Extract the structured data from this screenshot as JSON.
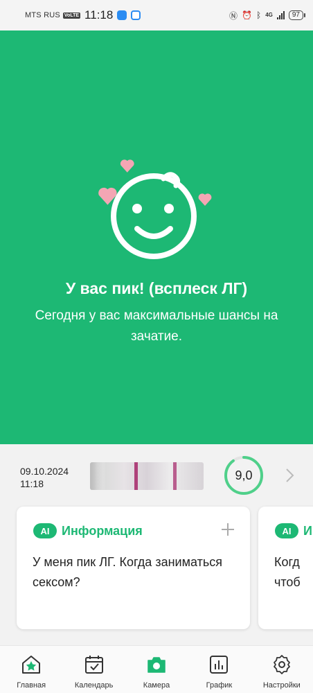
{
  "status_bar": {
    "carrier": "MTS RUS",
    "volte": "VoLTE",
    "time": "11:18",
    "network": "4G",
    "battery": "97",
    "icons": [
      "nfc-icon",
      "alarm-icon",
      "bluetooth-icon",
      "signal-icon",
      "battery-icon"
    ]
  },
  "hero": {
    "title": "У вас пик! (всплеск ЛГ)",
    "subtitle": "Сегодня у вас максимальные шансы на зачатие.",
    "background_color": "#1db874",
    "icon": "baby-face-icon",
    "heart_color": "#f4a6b4"
  },
  "result": {
    "date": "09.10.2024",
    "time": "11:18",
    "score": "9,0",
    "score_fraction": 0.9,
    "gauge_color": "#4fd08a"
  },
  "cards": [
    {
      "badge": "AI",
      "title": "Информация",
      "body": "У меня пик ЛГ. Когда заниматься сексом?"
    },
    {
      "badge": "AI",
      "title": "Информация",
      "body": "Когд\nчтоб"
    }
  ],
  "nav": [
    {
      "label": "Главная",
      "icon": "home-star-icon",
      "active": true
    },
    {
      "label": "Календарь",
      "icon": "calendar-icon",
      "active": false
    },
    {
      "label": "Камера",
      "icon": "camera-icon",
      "active": false
    },
    {
      "label": "График",
      "icon": "chart-icon",
      "active": false
    },
    {
      "label": "Настройки",
      "icon": "gear-icon",
      "active": false
    }
  ]
}
